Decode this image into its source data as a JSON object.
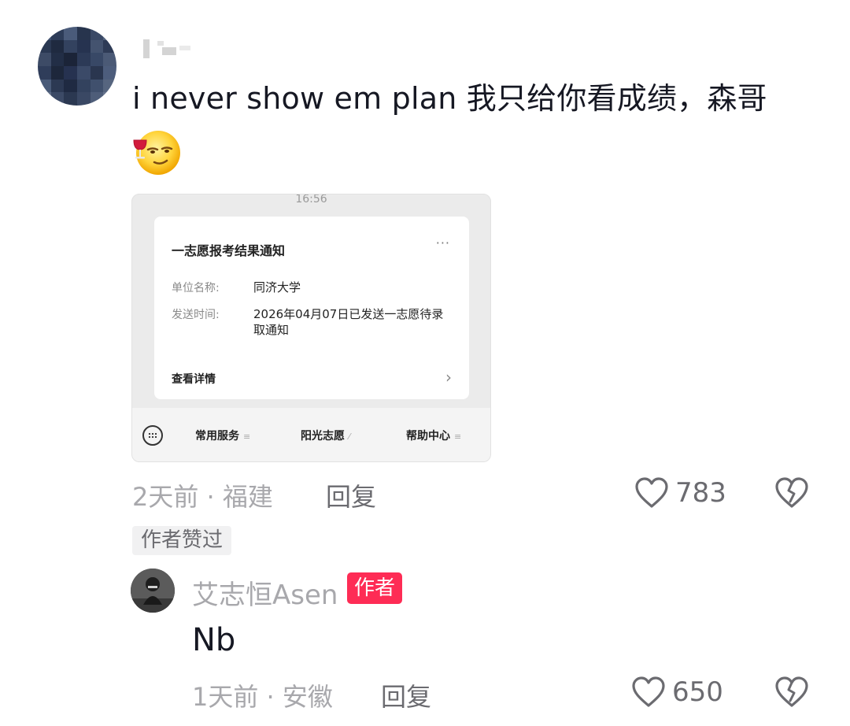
{
  "comment": {
    "text": "i never show em plan 我只给你看成绩，森哥",
    "emoji": "wine-smirk-emoji",
    "meta": "2天前 · 福建",
    "reply_label": "回复",
    "likes": "783",
    "liked_by_author_label": "作者赞过"
  },
  "screenshot": {
    "time": "16:56",
    "card_title": "一志愿报考结果通知",
    "more": "···",
    "fields": [
      {
        "label": "单位名称:",
        "value": "同济大学"
      },
      {
        "label": "发送时间:",
        "value": "2026年04月07日已发送一志愿待录取通知"
      }
    ],
    "detail_label": "查看详情",
    "bottom_bar": [
      {
        "label": "常用服务",
        "suffix": "≡"
      },
      {
        "label": "阳光志愿",
        "suffix": "⁄"
      },
      {
        "label": "帮助中心",
        "suffix": "≡"
      }
    ]
  },
  "reply": {
    "author": "艾志恒Asen",
    "badge": "作者",
    "text": "Nb",
    "meta": "1天前 · 安徽",
    "reply_label": "回复",
    "likes": "650"
  },
  "colors": {
    "accent": "#fe2c55",
    "meta_text": "#a8a8ac",
    "icon_gray": "#6b6b70"
  }
}
